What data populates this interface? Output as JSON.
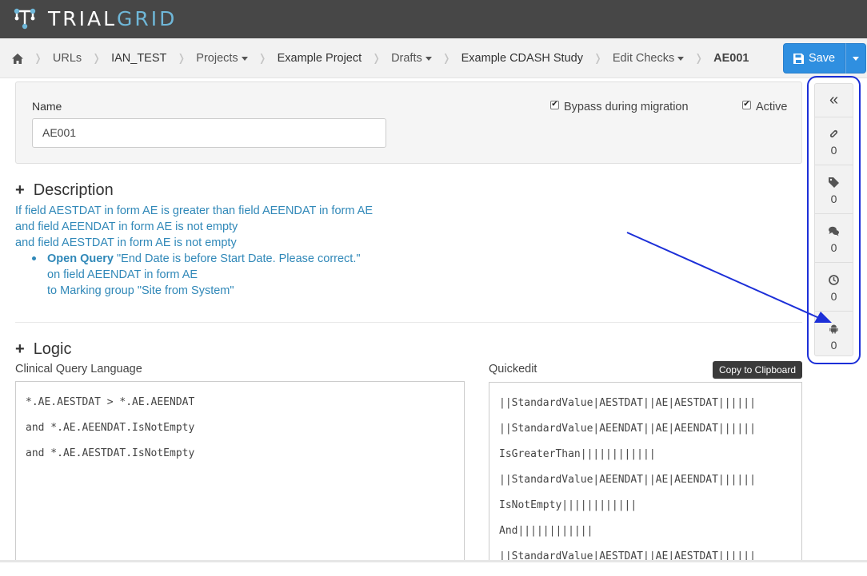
{
  "app": {
    "logo_text_1": "TRIAL",
    "logo_text_2": "GRID"
  },
  "breadcrumb": {
    "items": [
      "URLs",
      "IAN_TEST",
      "Projects",
      "Example Project",
      "Drafts",
      "Example CDASH Study",
      "Edit Checks",
      "AE001"
    ]
  },
  "toolbar": {
    "save_label": "Save"
  },
  "form": {
    "name_label": "Name",
    "name_value": "AE001",
    "bypass_label": "Bypass during migration",
    "active_label": "Active",
    "bypass_checked": true,
    "active_checked": true
  },
  "description": {
    "heading": "Description",
    "lines": [
      "If field AESTDAT in form AE is greater than field AEENDAT in form AE",
      "and field AEENDAT in form AE is not empty",
      "and field AESTDAT in form AE is not empty"
    ],
    "action_label": "Open Query",
    "action_text": " \"End Date is before Start Date. Please correct.\"",
    "action_line2": "on field AEENDAT in form AE",
    "action_line3": "to Marking group \"Site from System\""
  },
  "logic": {
    "heading": "Logic",
    "cql_label": "Clinical Query Language",
    "cql_lines": [
      "*.AE.AESTDAT > *.AE.AEENDAT",
      "and *.AE.AEENDAT.IsNotEmpty",
      "and *.AE.AESTDAT.IsNotEmpty"
    ],
    "quickedit_label": "Quickedit",
    "copy_label": "Copy to Clipboard",
    "quickedit_lines": [
      "||StandardValue|AESTDAT||AE|AESTDAT||||||",
      "||StandardValue|AEENDAT||AE|AEENDAT||||||",
      "IsGreaterThan||||||||||||",
      "||StandardValue|AEENDAT||AE|AEENDAT||||||",
      "IsNotEmpty||||||||||||",
      "And||||||||||||",
      "||StandardValue|AESTDAT||AE|AESTDAT||||||"
    ]
  },
  "side_panel": {
    "collapse_icon": "double-chevron-left-icon",
    "items": [
      {
        "icon": "paperclip-icon",
        "count": "0"
      },
      {
        "icon": "tag-icon",
        "count": "0"
      },
      {
        "icon": "comments-icon",
        "count": "0"
      },
      {
        "icon": "clock-icon",
        "count": "0"
      },
      {
        "icon": "android-icon",
        "count": "0"
      }
    ]
  },
  "colors": {
    "accent": "#2f8fe0",
    "link": "#3088b8",
    "annotation": "#1c2fd8",
    "topbar": "#474747"
  }
}
